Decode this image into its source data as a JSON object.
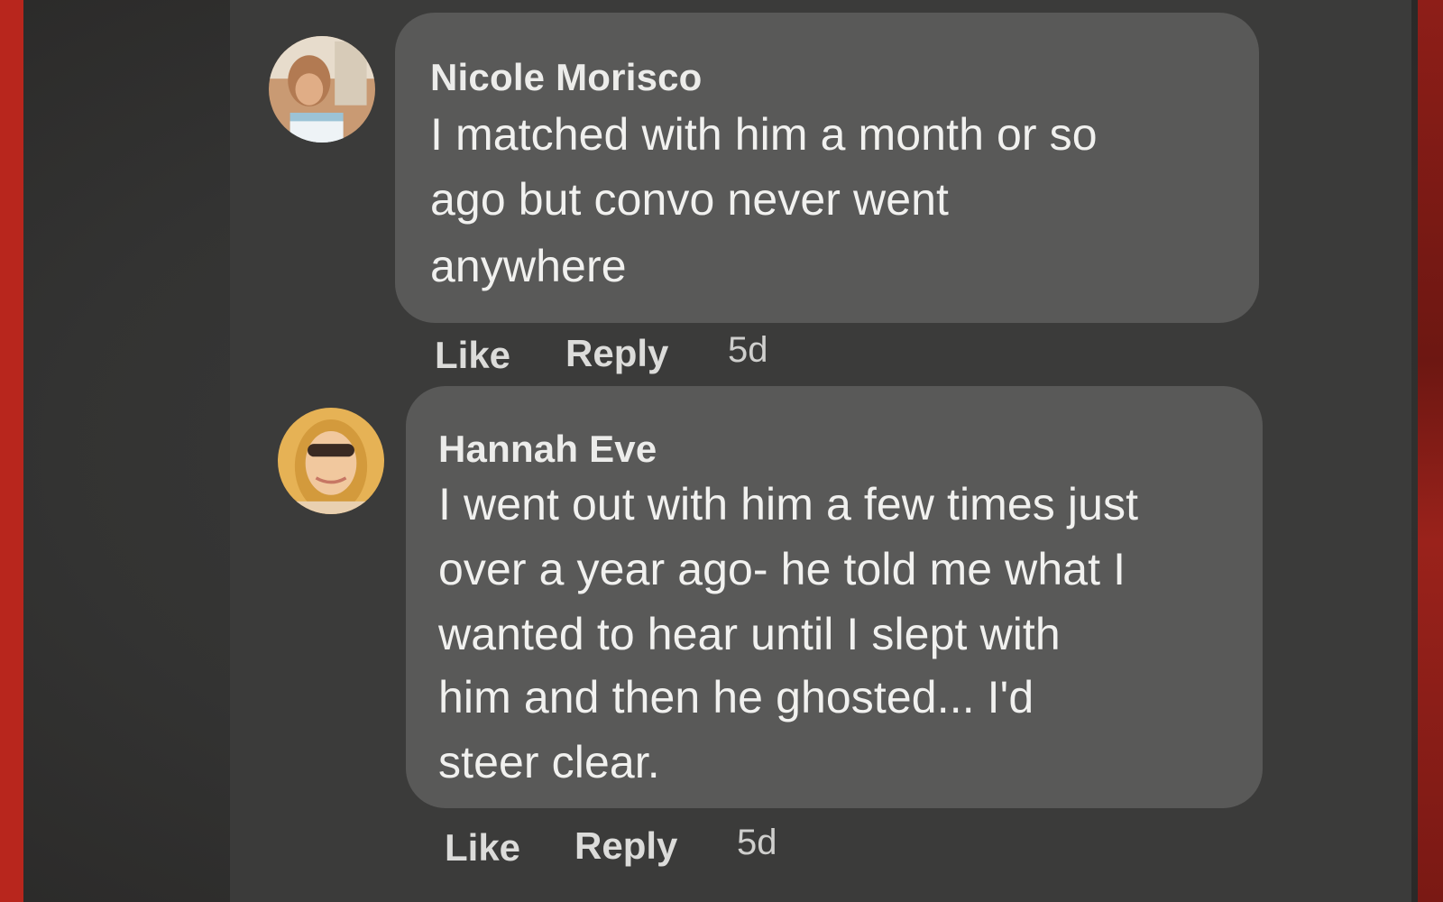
{
  "colors": {
    "background_red": "#b8261d",
    "screen_dark": "#333332",
    "bubble": "#595958",
    "text": "#f1f1ef"
  },
  "comments": [
    {
      "author": "Nicole Morisco",
      "avatar_icon": "profile-photo-icon",
      "lines": [
        "I matched with him a month or so",
        "ago but convo never went",
        "anywhere"
      ],
      "like_label": "Like",
      "reply_label": "Reply",
      "timestamp": "5d"
    },
    {
      "author": "Hannah Eve",
      "avatar_icon": "profile-photo-icon",
      "lines": [
        "I went out with him a few times just",
        "over a year ago- he told me what I",
        "wanted to hear until I slept with",
        "him and then he ghosted... I'd",
        "steer clear."
      ],
      "like_label": "Like",
      "reply_label": "Reply",
      "timestamp": "5d"
    }
  ]
}
